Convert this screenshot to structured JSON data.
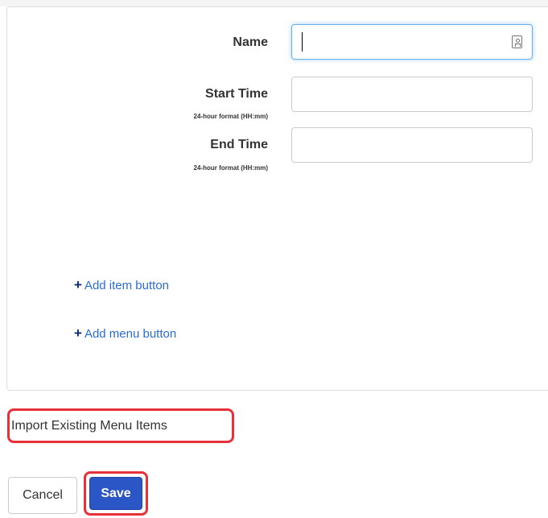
{
  "form": {
    "name_label": "Name",
    "name_value": "",
    "start_label": "Start Time",
    "start_hint": "24-hour format (HH:mm)",
    "start_value": "",
    "end_label": "End Time",
    "end_hint": "24-hour format (HH:mm)",
    "end_value": "",
    "field_icon": "contact-card-icon"
  },
  "links": {
    "add_item": "Add item button",
    "add_menu": "Add menu button",
    "plus_icon": "plus-icon"
  },
  "actions": {
    "import_label": "Import Existing Menu Items",
    "cancel_label": "Cancel",
    "save_label": "Save"
  },
  "colors": {
    "link": "#2a6bd6",
    "primary": "#2a56c6",
    "highlight": "#e8303a",
    "focus": "#66afe9"
  }
}
